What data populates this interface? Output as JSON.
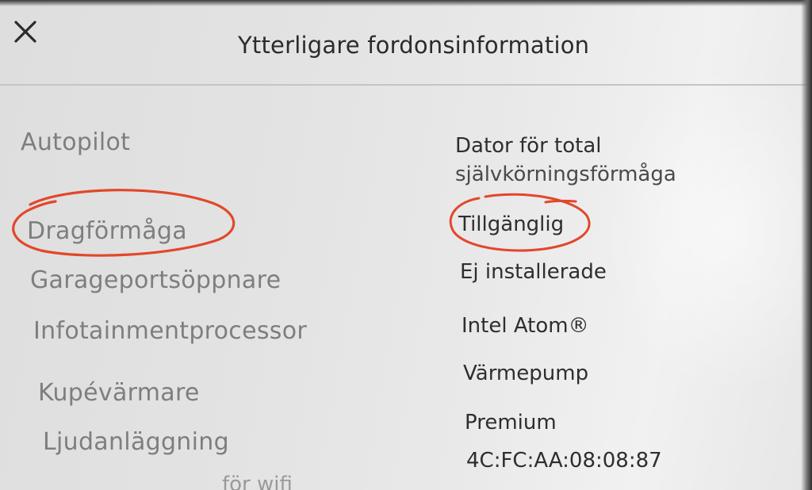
{
  "header": {
    "title": "Ytterligare fordonsinformation",
    "close_icon": "close-icon"
  },
  "rows": [
    {
      "label": "Autopilot",
      "value_lines": [
        "Dator för total",
        "självkörningsförmåga"
      ]
    },
    {
      "label": "Dragförmåga",
      "value": "Tillgänglig"
    },
    {
      "label": "Garageportsöppnare",
      "value": "Ej installerade"
    },
    {
      "label": "Infotainmentprocessor",
      "value": "Intel Atom®"
    },
    {
      "label": "Kupévärmare",
      "value": "Värmepump"
    },
    {
      "label": "Ljudanläggning",
      "value": "Premium"
    }
  ],
  "partial_row": {
    "label_fragment": "för wifi",
    "value": "4C:FC:AA:08:08:87"
  },
  "annotation_color": "#e2472b"
}
